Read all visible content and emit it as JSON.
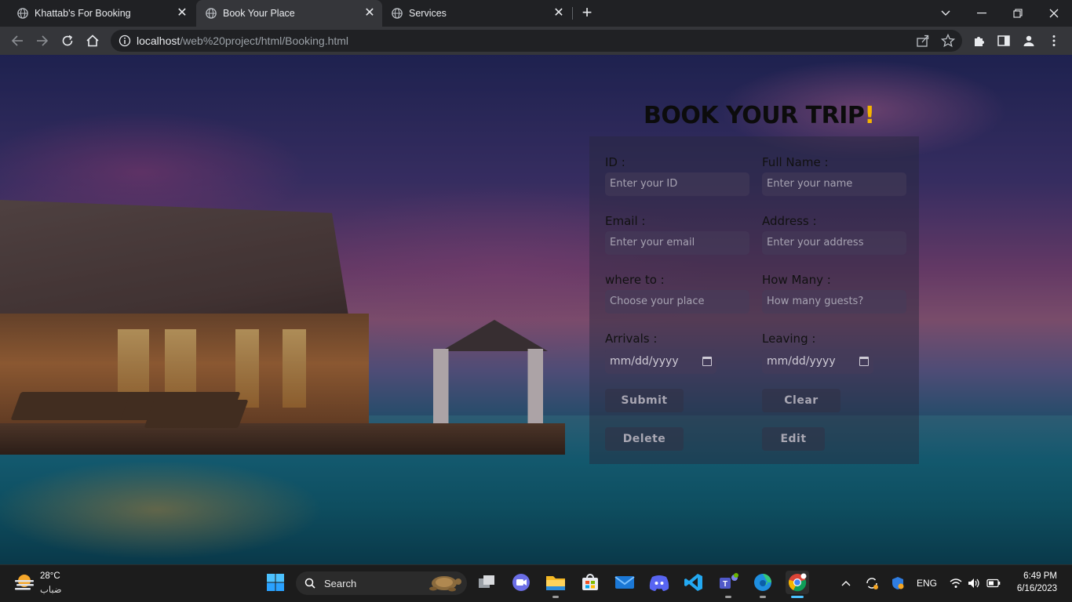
{
  "browser": {
    "tabs": [
      {
        "title": "Khattab's For Booking",
        "active": false
      },
      {
        "title": "Book Your Place",
        "active": true
      },
      {
        "title": "Services",
        "active": false
      }
    ],
    "url_host": "localhost",
    "url_path": "/web%20project/html/Booking.html"
  },
  "page": {
    "heading": "BOOK YOUR TRIP",
    "heading_accent": "!",
    "fields": {
      "id": {
        "label": "ID :",
        "placeholder": "Enter your ID"
      },
      "full_name": {
        "label": "Full Name :",
        "placeholder": "Enter your name"
      },
      "email": {
        "label": "Email :",
        "placeholder": "Enter your email"
      },
      "address": {
        "label": "Address :",
        "placeholder": "Enter your address"
      },
      "where_to": {
        "label": "where to :",
        "placeholder": "Choose your place"
      },
      "how_many": {
        "label": "How Many :",
        "placeholder": "How many guests?"
      },
      "arrivals": {
        "label": "Arrivals :",
        "value": "mm/dd/yyyy"
      },
      "leaving": {
        "label": "Leaving :",
        "value": "mm/dd/yyyy"
      }
    },
    "buttons": {
      "submit": "Submit",
      "clear": "Clear",
      "delete": "Delete",
      "edit": "Edit"
    }
  },
  "taskbar": {
    "weather_temp": "28°C",
    "weather_desc": "ضباب",
    "search_label": "Search",
    "language": "ENG",
    "time": "6:49 PM",
    "date": "6/16/2023"
  },
  "colors": {
    "accent_bang": "#f5b400",
    "chrome_dark": "#202124",
    "chrome_toolbar": "#35363a"
  }
}
